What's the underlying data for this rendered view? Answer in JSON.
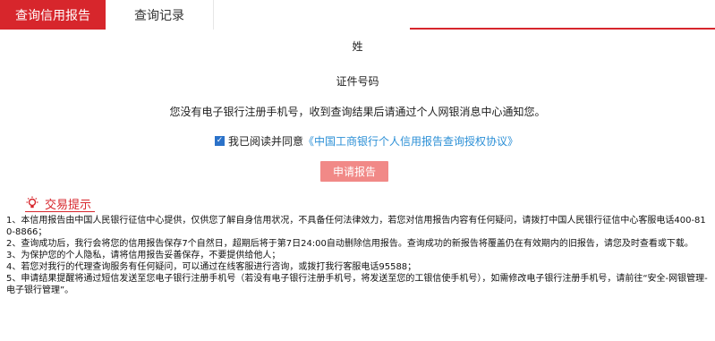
{
  "tabs": [
    {
      "label": "查询信用报告",
      "active": true
    },
    {
      "label": "查询记录",
      "active": false
    }
  ],
  "form": {
    "name_label": "姓",
    "id_label": "证件号码",
    "notice": "您没有电子银行注册手机号，收到查询结果后请通过个人网银消息中心通知您。",
    "agree_prefix": "我已阅读并同意",
    "agree_link": "《中国工商银行个人信用报告查询授权协议》",
    "agree_checked": true,
    "apply_button": "申请报告"
  },
  "tips": {
    "title": "交易提示",
    "items": [
      "1、本信用报告由中国人民银行征信中心提供，仅供您了解自身信用状况，不具备任何法律效力，若您对信用报告内容有任何疑问，请拨打中国人民银行征信中心客服电话400-810-8866；",
      "2、查询成功后，我行会将您的信用报告保存7个自然日，超期后将于第7日24:00自动删除信用报告。查询成功的新报告将覆盖仍在有效期内的旧报告，请您及时查看或下载。",
      "3、为保护您的个人隐私，请将信用报告妥善保存，不要提供给他人；",
      "4、若您对我行的代理查询服务有任何疑问，可以通过在线客服进行咨询，或拨打我行客服电话95588；",
      "5、申请结果提醒将通过短信发送至您电子银行注册手机号（若没有电子银行注册手机号，将发送至您的工银信使手机号），如需修改电子银行注册手机号，请前往“安全-网银管理-电子银行管理”。"
    ]
  },
  "colors": {
    "brand_red": "#d7262c",
    "link_blue": "#2b8fd6",
    "button_pink": "#f18987"
  },
  "icons": {
    "tips_icon": "lightbulb-icon",
    "checkbox_icon": "checkmark-icon"
  }
}
